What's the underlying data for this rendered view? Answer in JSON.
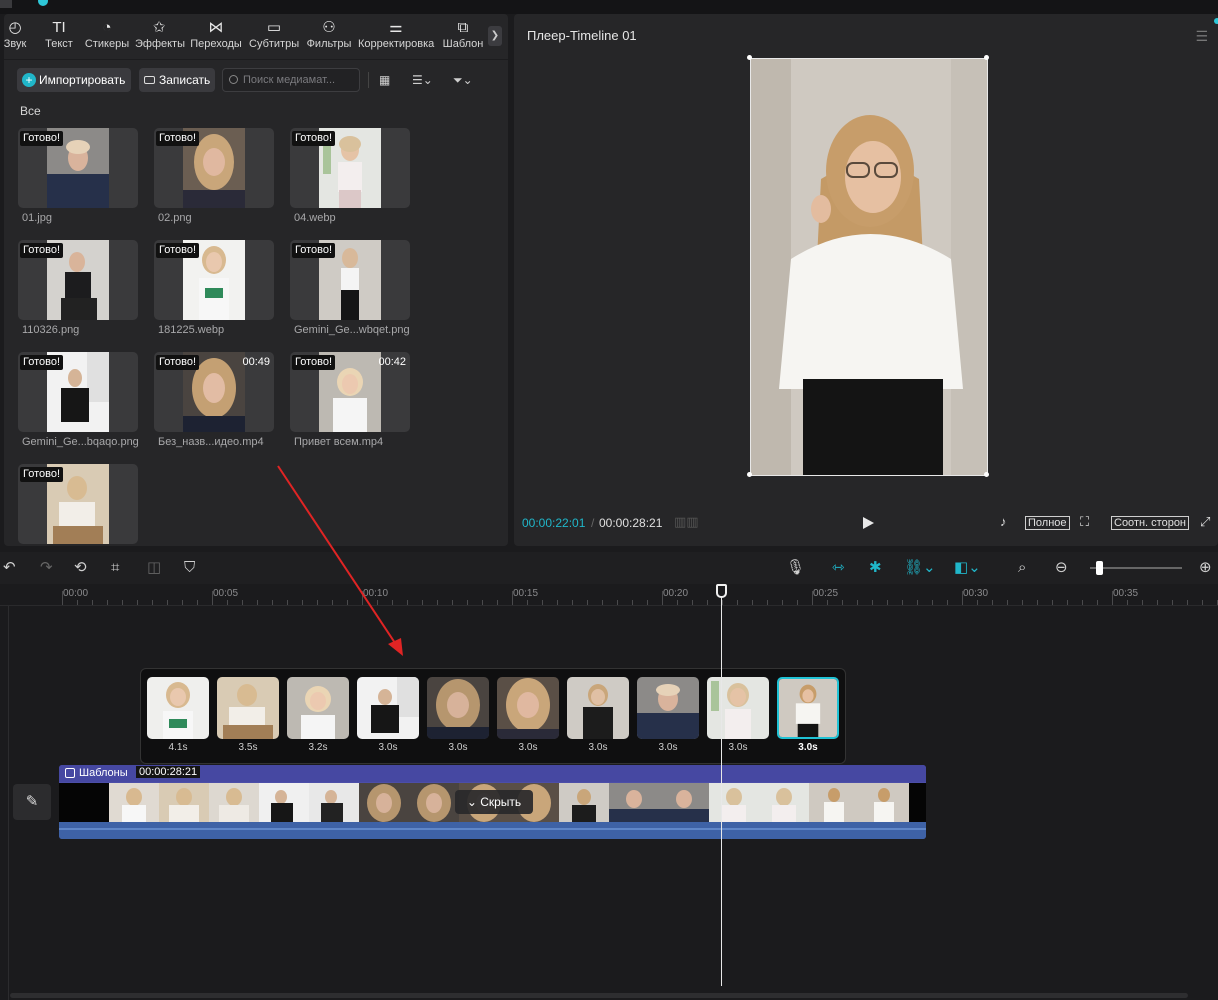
{
  "toolbar": {
    "tabs": [
      {
        "label": "Звук",
        "icon": "audio-icon"
      },
      {
        "label": "Текст",
        "icon": "text-icon"
      },
      {
        "label": "Стикеры",
        "icon": "sticker-icon"
      },
      {
        "label": "Эффекты",
        "icon": "effects-icon"
      },
      {
        "label": "Переходы",
        "icon": "transitions-icon"
      },
      {
        "label": "Субтитры",
        "icon": "subtitles-icon"
      },
      {
        "label": "Фильтры",
        "icon": "filters-icon"
      },
      {
        "label": "Корректировка",
        "icon": "adjust-icon"
      },
      {
        "label": "Шаблон",
        "icon": "template-icon"
      }
    ]
  },
  "media": {
    "import_label": "Импортировать",
    "record_label": "Записать",
    "search_placeholder": "Поиск медиамат...",
    "section_label": "Все",
    "items": [
      {
        "badge": "Готово!",
        "name": "01.jpg",
        "duration": ""
      },
      {
        "badge": "Готово!",
        "name": "02.png",
        "duration": ""
      },
      {
        "badge": "Готово!",
        "name": "04.webp",
        "duration": ""
      },
      {
        "badge": "Готово!",
        "name": "110326.png",
        "duration": ""
      },
      {
        "badge": "Готово!",
        "name": "181225.webp",
        "duration": ""
      },
      {
        "badge": "Готово!",
        "name": "Gemini_Ge...wbqet.png",
        "duration": ""
      },
      {
        "badge": "Готово!",
        "name": "Gemini_Ge...bqaqo.png",
        "duration": ""
      },
      {
        "badge": "Готово!",
        "name": "Без_назв...идео.mp4",
        "duration": "00:49"
      },
      {
        "badge": "Готово!",
        "name": "Привет всем.mp4",
        "duration": "00:42"
      },
      {
        "badge": "Готово!",
        "name": "",
        "duration": ""
      }
    ]
  },
  "player": {
    "title": "Плеер-Timeline 01",
    "current_time": "00:00:22:01",
    "separator": "/",
    "total_time": "00:00:28:21",
    "full_label": "Полное",
    "ratio_label": "Соотн. сторон"
  },
  "ruler": {
    "labels": [
      "00:00",
      "00:05",
      "00:10",
      "00:15",
      "00:20",
      "00:25",
      "00:30",
      "00:35"
    ]
  },
  "templates": {
    "durations": [
      "4.1s",
      "3.5s",
      "3.2s",
      "3.0s",
      "3.0s",
      "3.0s",
      "3.0s",
      "3.0s",
      "3.0s",
      "3.0s"
    ],
    "selected_index": 9
  },
  "track": {
    "name": "Шаблоны",
    "duration": "00:00:28:21",
    "hide_label": "Скрыть"
  },
  "colors": {
    "accent": "#20b6c9",
    "track": "#4c4ea8",
    "annotation_arrow": "#e02424"
  }
}
